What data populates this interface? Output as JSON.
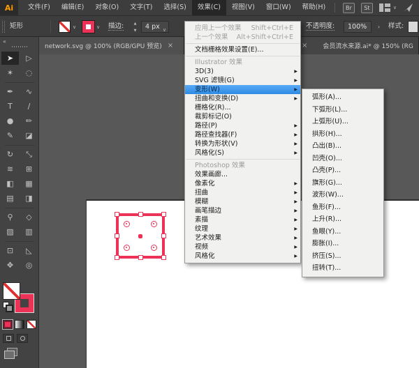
{
  "colors": {
    "accent_pink": "#ec3357",
    "menu_highlight_blue": "#3a9bf0",
    "logo_orange": "#ff9a00",
    "menu_bg": "#f1f1f0"
  },
  "icons": {
    "close": "×",
    "chevron_down": "∨",
    "submenu_arrow": "▶",
    "collapse": "«",
    "stepper_up": "▲",
    "stepper_down": "▼",
    "next": "›"
  },
  "menubar": {
    "logo": "Ai",
    "items": [
      {
        "name": "file",
        "label": "文件(F)"
      },
      {
        "name": "edit",
        "label": "编辑(E)"
      },
      {
        "name": "object",
        "label": "对象(O)"
      },
      {
        "name": "type",
        "label": "文字(T)"
      },
      {
        "name": "select",
        "label": "选择(S)"
      },
      {
        "name": "effect",
        "label": "效果(C)",
        "active": true
      },
      {
        "name": "view",
        "label": "视图(V)"
      },
      {
        "name": "window",
        "label": "窗口(W)"
      },
      {
        "name": "help",
        "label": "帮助(H)"
      }
    ],
    "right_buttons": [
      {
        "name": "bridge",
        "label": "Br"
      },
      {
        "name": "stock",
        "label": "St"
      }
    ]
  },
  "control_bar": {
    "object_label": "矩形",
    "stroke_label": "描边:",
    "stroke_value": "4 px",
    "opacity_label": "不透明度:",
    "opacity_value": "100%",
    "style_label": "样式:"
  },
  "tabs": [
    {
      "title": "network.svg @ 100% (RGB/GPU 预览)",
      "active": true
    },
    {
      "title": "会员流水来源.ai* @ 150% (RG",
      "active": false
    }
  ],
  "toolbar": {
    "tools": [
      {
        "name": "selection",
        "glyph": "➤",
        "active": true
      },
      {
        "name": "direct-selection",
        "glyph": "▷"
      },
      {
        "name": "magic-wand",
        "glyph": "✶"
      },
      {
        "name": "lasso",
        "glyph": "◌"
      },
      {
        "sep": true
      },
      {
        "name": "pen",
        "glyph": "✒"
      },
      {
        "name": "curvature",
        "glyph": "∿"
      },
      {
        "name": "type-tool",
        "glyph": "T"
      },
      {
        "name": "line-segment",
        "glyph": "∕"
      },
      {
        "name": "ellipse",
        "glyph": "●"
      },
      {
        "name": "paintbrush",
        "glyph": "✏"
      },
      {
        "name": "pencil",
        "glyph": "✎"
      },
      {
        "name": "eraser",
        "glyph": "◪"
      },
      {
        "sep": true
      },
      {
        "name": "rotate",
        "glyph": "↻"
      },
      {
        "name": "scale",
        "glyph": "⤡"
      },
      {
        "name": "width",
        "glyph": "≋"
      },
      {
        "name": "free-transform",
        "glyph": "⊞"
      },
      {
        "name": "shape-builder",
        "glyph": "◧"
      },
      {
        "name": "perspective-grid",
        "glyph": "▦"
      },
      {
        "name": "mesh",
        "glyph": "▤"
      },
      {
        "name": "gradient",
        "glyph": "◨"
      },
      {
        "sep": true
      },
      {
        "name": "eyedropper",
        "glyph": "⚲"
      },
      {
        "name": "blend",
        "glyph": "◇"
      },
      {
        "name": "symbol-sprayer",
        "glyph": "▨"
      },
      {
        "name": "column-graph",
        "glyph": "▥"
      },
      {
        "sep": true
      },
      {
        "name": "artboard-tool",
        "glyph": "⊡"
      },
      {
        "name": "slice",
        "glyph": "◺"
      },
      {
        "name": "hand",
        "glyph": "✥"
      },
      {
        "name": "zoom",
        "glyph": "◎"
      }
    ]
  },
  "effects_menu": {
    "items": [
      {
        "name": "apply-last-effect",
        "label": "应用上一个效果",
        "shortcut": "Shift+Ctrl+E",
        "disabled": true
      },
      {
        "name": "last-effect",
        "label": "上一个效果",
        "shortcut": "Alt+Shift+Ctrl+E",
        "disabled": true
      },
      {
        "sep": true
      },
      {
        "name": "document-raster-effects-settings",
        "label": "文档栅格效果设置(E)..."
      },
      {
        "sep": true
      },
      {
        "name": "header-illustrator-effects",
        "label": "Illustrator 效果",
        "header": true
      },
      {
        "name": "3d",
        "label": "3D(3)",
        "submenu": true
      },
      {
        "name": "svg-filters",
        "label": "SVG 滤镜(G)",
        "submenu": true
      },
      {
        "name": "warp",
        "label": "变形(W)",
        "submenu": true,
        "highlighted": true
      },
      {
        "name": "distort-and-transform",
        "label": "扭曲和变换(D)",
        "submenu": true
      },
      {
        "name": "rasterize",
        "label": "栅格化(R)..."
      },
      {
        "name": "crop-marks",
        "label": "裁剪标记(O)"
      },
      {
        "name": "path",
        "label": "路径(P)",
        "submenu": true
      },
      {
        "name": "pathfinder",
        "label": "路径查找器(F)",
        "submenu": true
      },
      {
        "name": "convert-to-shape",
        "label": "转换为形状(V)",
        "submenu": true
      },
      {
        "name": "stylize",
        "label": "风格化(S)",
        "submenu": true
      },
      {
        "sep": true
      },
      {
        "name": "header-photoshop-effects",
        "label": "Photoshop 效果",
        "header": true
      },
      {
        "name": "effect-gallery",
        "label": "效果画廊..."
      },
      {
        "name": "pixelate",
        "label": "像素化",
        "submenu": true
      },
      {
        "name": "distort",
        "label": "扭曲",
        "submenu": true
      },
      {
        "name": "blur",
        "label": "模糊",
        "submenu": true
      },
      {
        "name": "brush-strokes",
        "label": "画笔描边",
        "submenu": true
      },
      {
        "name": "sketch",
        "label": "素描",
        "submenu": true
      },
      {
        "name": "texture",
        "label": "纹理",
        "submenu": true
      },
      {
        "name": "artistic",
        "label": "艺术效果",
        "submenu": true
      },
      {
        "name": "video",
        "label": "视频",
        "submenu": true
      },
      {
        "name": "stylize-ps",
        "label": "风格化",
        "submenu": true
      }
    ]
  },
  "warp_submenu": {
    "items": [
      {
        "name": "arc",
        "label": "弧形(A)..."
      },
      {
        "name": "arc-lower",
        "label": "下弧形(L)..."
      },
      {
        "name": "arc-upper",
        "label": "上弧形(U)..."
      },
      {
        "name": "arch",
        "label": "拱形(H)..."
      },
      {
        "name": "bulge",
        "label": "凸出(B)..."
      },
      {
        "name": "shell-lower",
        "label": "凹壳(O)..."
      },
      {
        "name": "shell-upper",
        "label": "凸壳(P)..."
      },
      {
        "name": "flag",
        "label": "旗形(G)..."
      },
      {
        "name": "wave",
        "label": "波形(W)..."
      },
      {
        "name": "fish",
        "label": "鱼形(F)..."
      },
      {
        "name": "rise",
        "label": "上升(R)..."
      },
      {
        "name": "fisheye",
        "label": "鱼眼(Y)..."
      },
      {
        "name": "inflate",
        "label": "膨胀(I)..."
      },
      {
        "name": "squeeze",
        "label": "挤压(S)..."
      },
      {
        "name": "twist",
        "label": "扭转(T)..."
      }
    ]
  }
}
